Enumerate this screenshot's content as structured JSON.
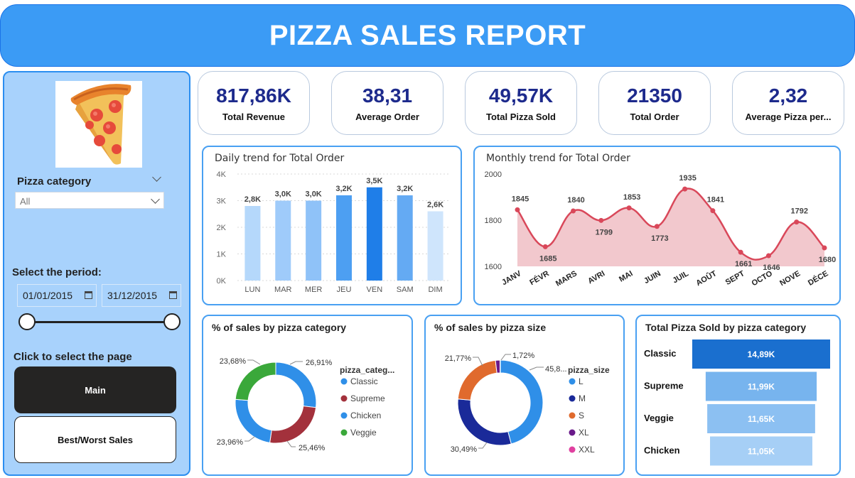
{
  "header": {
    "title": "PIZZA SALES REPORT"
  },
  "sidebar": {
    "category_label": "Pizza category",
    "category_value": "All",
    "period_label": "Select the period:",
    "date_start": "01/01/2015",
    "date_end": "31/12/2015",
    "page_label": "Click to select the page",
    "buttons": [
      "Main",
      "Best/Worst Sales"
    ]
  },
  "kpis": [
    {
      "value": "817,86K",
      "label": "Total Revenue"
    },
    {
      "value": "38,31",
      "label": "Average Order"
    },
    {
      "value": "49,57K",
      "label": "Total Pizza Sold"
    },
    {
      "value": "21350",
      "label": "Total Order"
    },
    {
      "value": "2,32",
      "label": "Average Pizza per..."
    }
  ],
  "colors": {
    "accent": "#3b9bf5",
    "kpi_value": "#1d2a8c",
    "line": "#d9485a"
  },
  "chart_data": [
    {
      "type": "bar",
      "title": "Daily trend for Total Order",
      "categories": [
        "LUN",
        "MAR",
        "MER",
        "JEU",
        "VEN",
        "SAM",
        "DIM"
      ],
      "values": [
        2800,
        3000,
        3000,
        3200,
        3500,
        3200,
        2600
      ],
      "labels": [
        "2,8K",
        "3,0K",
        "3,0K",
        "3,2K",
        "3,5K",
        "3,2K",
        "2,6K"
      ],
      "yticks": [
        "0K",
        "1K",
        "2K",
        "3K",
        "4K"
      ],
      "ylim": [
        0,
        4000
      ]
    },
    {
      "type": "area",
      "title": "Monthly trend for Total Order",
      "categories": [
        "JANV",
        "FÉVR",
        "MARS",
        "AVRI",
        "MAI",
        "JUIN",
        "JUIL",
        "AOÛT",
        "SEPT",
        "OCTO",
        "NOVE",
        "DÉCE"
      ],
      "values": [
        1845,
        1685,
        1840,
        1799,
        1853,
        1773,
        1935,
        1841,
        1661,
        1646,
        1792,
        1680
      ],
      "yticks": [
        "1600",
        "1800",
        "2000"
      ],
      "ylim": [
        1600,
        2000
      ]
    },
    {
      "type": "pie",
      "title": "% of sales by pizza category",
      "legend_title": "pizza_categ...",
      "series": [
        {
          "name": "Classic",
          "value": 26.91,
          "label": "26,91%",
          "color": "#2f8fe8"
        },
        {
          "name": "Supreme",
          "value": 25.46,
          "label": "25,46%",
          "color": "#a3313c"
        },
        {
          "name": "Chicken",
          "value": 23.96,
          "label": "23,96%",
          "color": "#2f8fe8"
        },
        {
          "name": "Veggie",
          "value": 23.68,
          "label": "23,68%",
          "color": "#3aa83a"
        }
      ]
    },
    {
      "type": "pie",
      "title": "% of sales by pizza size",
      "legend_title": "pizza_size",
      "series": [
        {
          "name": "L",
          "value": 45.89,
          "label": "45,8...",
          "color": "#2f8fe8"
        },
        {
          "name": "M",
          "value": 30.49,
          "label": "30,49%",
          "color": "#1a2a99"
        },
        {
          "name": "S",
          "value": 21.77,
          "label": "21,77%",
          "color": "#e06a2d"
        },
        {
          "name": "XL",
          "value": 1.72,
          "label": "1,72%",
          "color": "#6a1a8a"
        },
        {
          "name": "XXL",
          "value": 0.12,
          "label": "",
          "color": "#e040a0"
        }
      ]
    },
    {
      "type": "bar",
      "title": "Total Pizza Sold by pizza category",
      "categories": [
        "Classic",
        "Supreme",
        "Veggie",
        "Chicken"
      ],
      "values": [
        14890,
        11990,
        11650,
        11050
      ],
      "labels": [
        "14,89K",
        "11,99K",
        "11,65K",
        "11,05K"
      ],
      "colors": [
        "#1a6fcf",
        "#77b4ee",
        "#8cc0f2",
        "#a6cff6"
      ]
    }
  ]
}
